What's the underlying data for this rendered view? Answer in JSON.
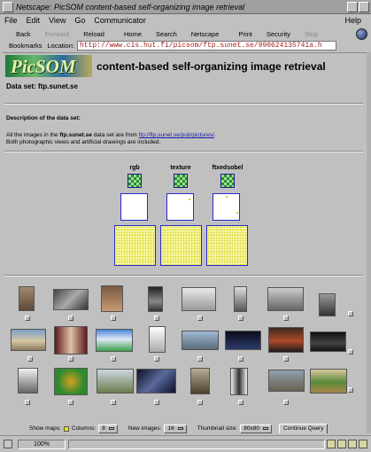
{
  "window": {
    "title": "Netscape: PicSOM content-based self-organizing image retrieval"
  },
  "menu": {
    "items": [
      "File",
      "Edit",
      "View",
      "Go",
      "Communicator"
    ],
    "help": "Help"
  },
  "toolbar": {
    "back": "Back",
    "forward": "Forward",
    "reload": "Reload",
    "home": "Home",
    "search": "Search",
    "netscape": "Netscape",
    "print": "Print",
    "security": "Security",
    "stop": "Stop"
  },
  "location": {
    "bookmarks": "Bookmarks",
    "label": "Location:",
    "url": "http://www.cis.hut.fi/picsom/ftp.sunet.se/990624135741a.h"
  },
  "page": {
    "logo_text": "PicSOM",
    "title": "content-based self-organizing image retrieval",
    "dataset_prefix": "Data set:",
    "dataset_name": "ftp.sunet.se",
    "description_heading": "Description of the data set:",
    "desc_part1": "All the images in the",
    "desc_strong": "ftp.sunet.se",
    "desc_part2": "data set are from",
    "desc_link": "ftp://ftp.sunet.se/pub/pictures/",
    "desc_part3": ".",
    "desc_line2": "Both photographic views and artificial drawings are included.",
    "features": [
      "rgb",
      "texture",
      "ftxedsobel"
    ]
  },
  "controls": {
    "show_maps": "Show maps:",
    "columns_label": "Columns:",
    "columns_value": "8",
    "new_images_label": "New images:",
    "new_images_value": "16",
    "thumb_size_label": "Thumbnail size:",
    "thumb_size_value": "80x80",
    "continue": "Continue Query"
  },
  "status": {
    "zoom": "100%"
  },
  "colors": {
    "chrome": "#c0c0c0",
    "link": "#1a1aa8",
    "map_border": "#2a2acc",
    "map_point": "#d3d300"
  }
}
